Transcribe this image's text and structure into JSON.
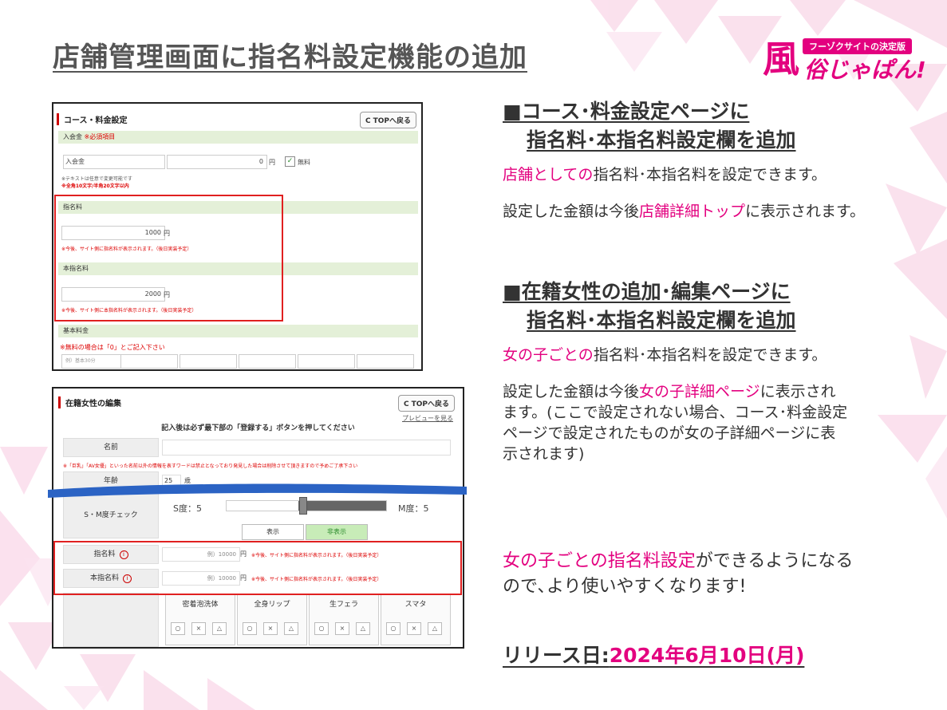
{
  "slide": {
    "title": "店舗管理画面に指名料設定機能の追加"
  },
  "logo": {
    "tag": "フーゾクサイトの決定版",
    "kanji": "風",
    "main": "俗じゃぱん!"
  },
  "shot1": {
    "panel_title": "コース・料金設定",
    "top_button": "TOPへ戻る",
    "entry_fee": {
      "header": "入会金",
      "required": "※必須項目",
      "name_value": "入会金",
      "amount_value": "0",
      "yen": "円",
      "free_label": "無料",
      "note1": "※テキストは任意で変更可能です",
      "note2": "※全角10文字/半角20文字以内"
    },
    "nomination_fee": {
      "header": "指名料",
      "value": "1000",
      "yen": "円",
      "note": "※今後、サイト側に指名料が表示されます。（後日実装予定）"
    },
    "main_nomination_fee": {
      "header": "本指名料",
      "value": "2000",
      "yen": "円",
      "note": "※今後、サイト側に本指名料が表示されます。（後日実装予定）"
    },
    "base_fee": {
      "header": "基本料金",
      "note": "※無料の場合は「0」とご記入下さい",
      "placeholder": "例）基本30分"
    }
  },
  "shot2": {
    "panel_title": "在籍女性の編集",
    "top_button": "TOPへ戻る",
    "preview_link": "プレビューを見る",
    "instruction": "記入後は必ず最下部の「登録する」ボタンを押してください",
    "name_label": "名前",
    "name_warning": "※「巨乳」「AV女優」といった名前以外の情報を表すワードは禁止となっており発見した場合は削除させて頂きますので予めご了承下さい",
    "age_label": "年齢",
    "age_value": "25",
    "age_unit": "歳",
    "sm_label": "S・M度チェック",
    "s_level": "S度：5",
    "m_level": "M度：5",
    "show_btn": "表示",
    "hide_btn": "非表示",
    "nomination_label": "指名料",
    "nomination_placeholder": "例）10000",
    "nomination_note": "※今後、サイト側に指名料が表示されます。（後日実装予定）",
    "main_nomination_label": "本指名料",
    "main_nomination_placeholder": "例）10000",
    "main_nomination_note": "※今後、サイト側に指名料が表示されます。（後日実装予定）",
    "yen": "円",
    "plays": [
      "密着泡洗体",
      "全身リップ",
      "生フェラ",
      "スマタ"
    ],
    "symbols": [
      "○",
      "×",
      "△"
    ]
  },
  "right": {
    "sec1_line1": "■コース･料金設定ページに",
    "sec1_line2": "指名料･本指名料設定欄を追加",
    "sec1_p1_pink": "店舗としての",
    "sec1_p1_rest": "指名料･本指名料を設定できます。",
    "sec1_p2_a": "設定した金額は今後",
    "sec1_p2_pink": "店舗詳細トップ",
    "sec1_p2_b": "に表示されます。",
    "sec2_line1": "■在籍女性の追加･編集ページに",
    "sec2_line2": "指名料･本指名料設定欄を追加",
    "sec2_p1_pink": "女の子ごとの",
    "sec2_p1_rest": "指名料･本指名料を設定できます。",
    "sec2_p2_a": "設定した金額は今後",
    "sec2_p2_pink": "女の子詳細ページ",
    "sec2_p2_b": "に表示され",
    "sec2_p2_line2": "ます。(ここで設定されない場合、コース･料金設定",
    "sec2_p2_line3": "ページで設定されたものが女の子詳細ページに表",
    "sec2_p2_line4": "示されます)",
    "summary_pink": "女の子ごとの指名料設定",
    "summary_rest": "ができるようになる",
    "summary_line2": "ので､より使いやすくなります!",
    "release_label": "リリース日:",
    "release_date": "2024年6月10日(月)"
  },
  "colors": {
    "accent_pink": "#e3007f",
    "highlight_red": "#e02020",
    "section_green": "#e4f0d8"
  }
}
